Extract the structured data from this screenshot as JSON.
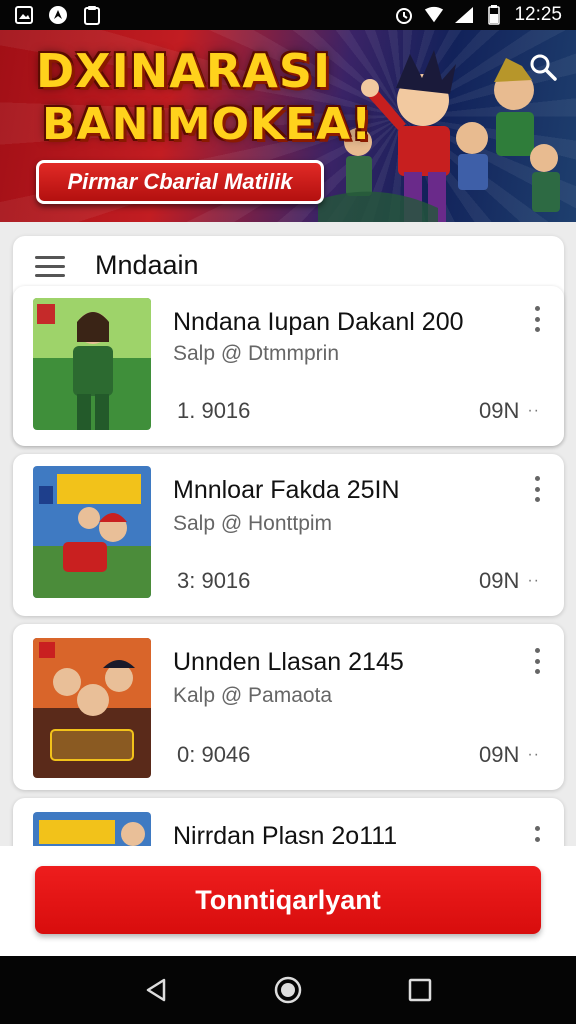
{
  "status_bar": {
    "time": "12:25",
    "left_icons": [
      "image-icon",
      "app-icon",
      "clipboard-icon"
    ],
    "right_icons": [
      "alarm-icon",
      "wifi-icon",
      "signal-icon",
      "battery-icon"
    ]
  },
  "banner": {
    "title_line1": "DXINARASI",
    "title_line2": "BANIMOKEA!",
    "subtitle": "Pirmar Cbarial Matilik",
    "search_icon": "search-icon"
  },
  "panel": {
    "menu_icon": "hamburger-menu-icon",
    "title": "Mndaain"
  },
  "items": [
    {
      "title": "Nndana Iupan Dakanl 200",
      "subtitle": "Salp @ Dtmmprin",
      "count": "1. 9016",
      "size": "09N",
      "more": "··"
    },
    {
      "title": "Mnnloar Fakda 25IN",
      "subtitle": "Salp @ Honttpim",
      "count": "3: 9016",
      "size": "09N",
      "more": "··"
    },
    {
      "title": "Unnden Llasan 2145",
      "subtitle": "Kalp @ Pamaota",
      "count": "0: 9046",
      "size": "09N",
      "more": "··"
    },
    {
      "title": "Nirrdan Plasn 2o111",
      "subtitle": "",
      "count": "",
      "size": "",
      "more": ""
    }
  ],
  "action": {
    "install_label": "Tonntiqarlyant"
  },
  "colors": {
    "accent": "#e21414",
    "banner_red": "#c21d22",
    "banner_blue": "#12225a",
    "title_yellow": "#ffd21c"
  },
  "nav": {
    "icons": [
      "back-icon",
      "home-icon",
      "recents-icon"
    ]
  }
}
